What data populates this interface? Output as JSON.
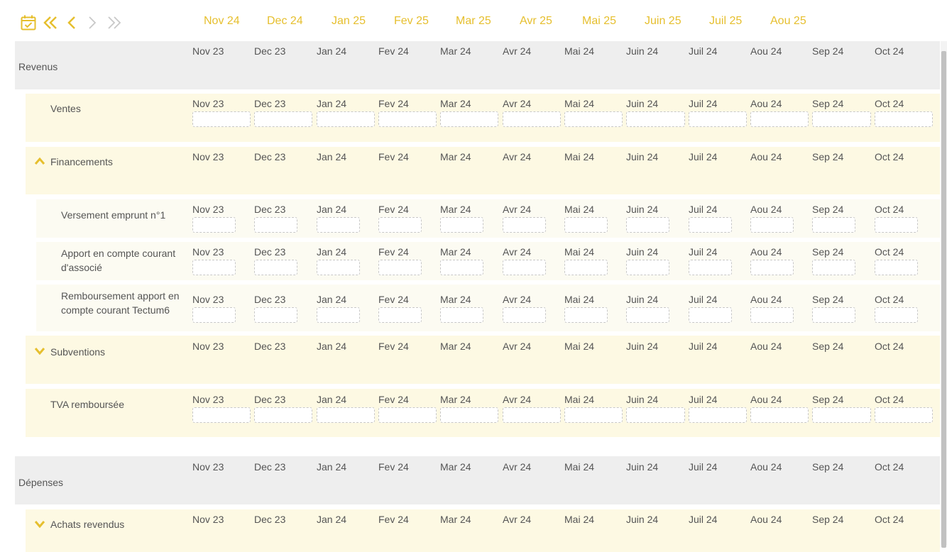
{
  "toolbar": {
    "icons": [
      "calendar-check-icon",
      "double-chevron-left-icon",
      "chevron-left-icon",
      "chevron-right-icon",
      "double-chevron-right-icon"
    ],
    "accent_color": "#e6bf2e",
    "months": [
      "Nov 24",
      "Dec 24",
      "Jan 25",
      "Fev 25",
      "Mar 25",
      "Avr 25",
      "Mai 25",
      "Juin 25",
      "Juil 25",
      "Aou 25"
    ]
  },
  "columns": [
    "Nov 23",
    "Dec 23",
    "Jan 24",
    "Fev 24",
    "Mar 24",
    "Avr 24",
    "Mai 24",
    "Juin 24",
    "Juil 24",
    "Aou 24",
    "Sep 24",
    "Oct 24"
  ],
  "colors": {
    "category_bg": "#eeeeee",
    "group_bg": "#fdf9e3",
    "subitem_bg": "#fcfbf2",
    "text": "#555555",
    "chevron": "#e6bf2e"
  },
  "rows": [
    {
      "id": "revenus",
      "level": 0,
      "label": "Revenus",
      "chevron": null,
      "inputs": false
    },
    {
      "id": "ventes",
      "level": 1,
      "label": "Ventes",
      "chevron": null,
      "inputs": true
    },
    {
      "id": "financements",
      "level": 1,
      "label": "Financements",
      "chevron": "up",
      "inputs": false
    },
    {
      "id": "versement-emprunt",
      "level": 2,
      "label": "Versement emprunt n°1",
      "chevron": null,
      "inputs": true
    },
    {
      "id": "apport-compte-courant",
      "level": 2,
      "label": "Apport en compte courant d'associé",
      "chevron": null,
      "inputs": true
    },
    {
      "id": "remboursement-apport",
      "level": 2,
      "label": "Remboursement apport en compte courant Tectum6",
      "chevron": null,
      "inputs": true
    },
    {
      "id": "subventions",
      "level": 1,
      "label": "Subventions",
      "chevron": "down",
      "inputs": false
    },
    {
      "id": "tva-remboursee",
      "level": 1,
      "label": "TVA remboursée",
      "chevron": null,
      "inputs": true
    },
    {
      "id": "depenses",
      "level": 0,
      "label": "Dépenses",
      "chevron": null,
      "inputs": false
    },
    {
      "id": "achats-revendus",
      "level": 1,
      "label": "Achats revendus",
      "chevron": "down",
      "inputs": false
    }
  ]
}
